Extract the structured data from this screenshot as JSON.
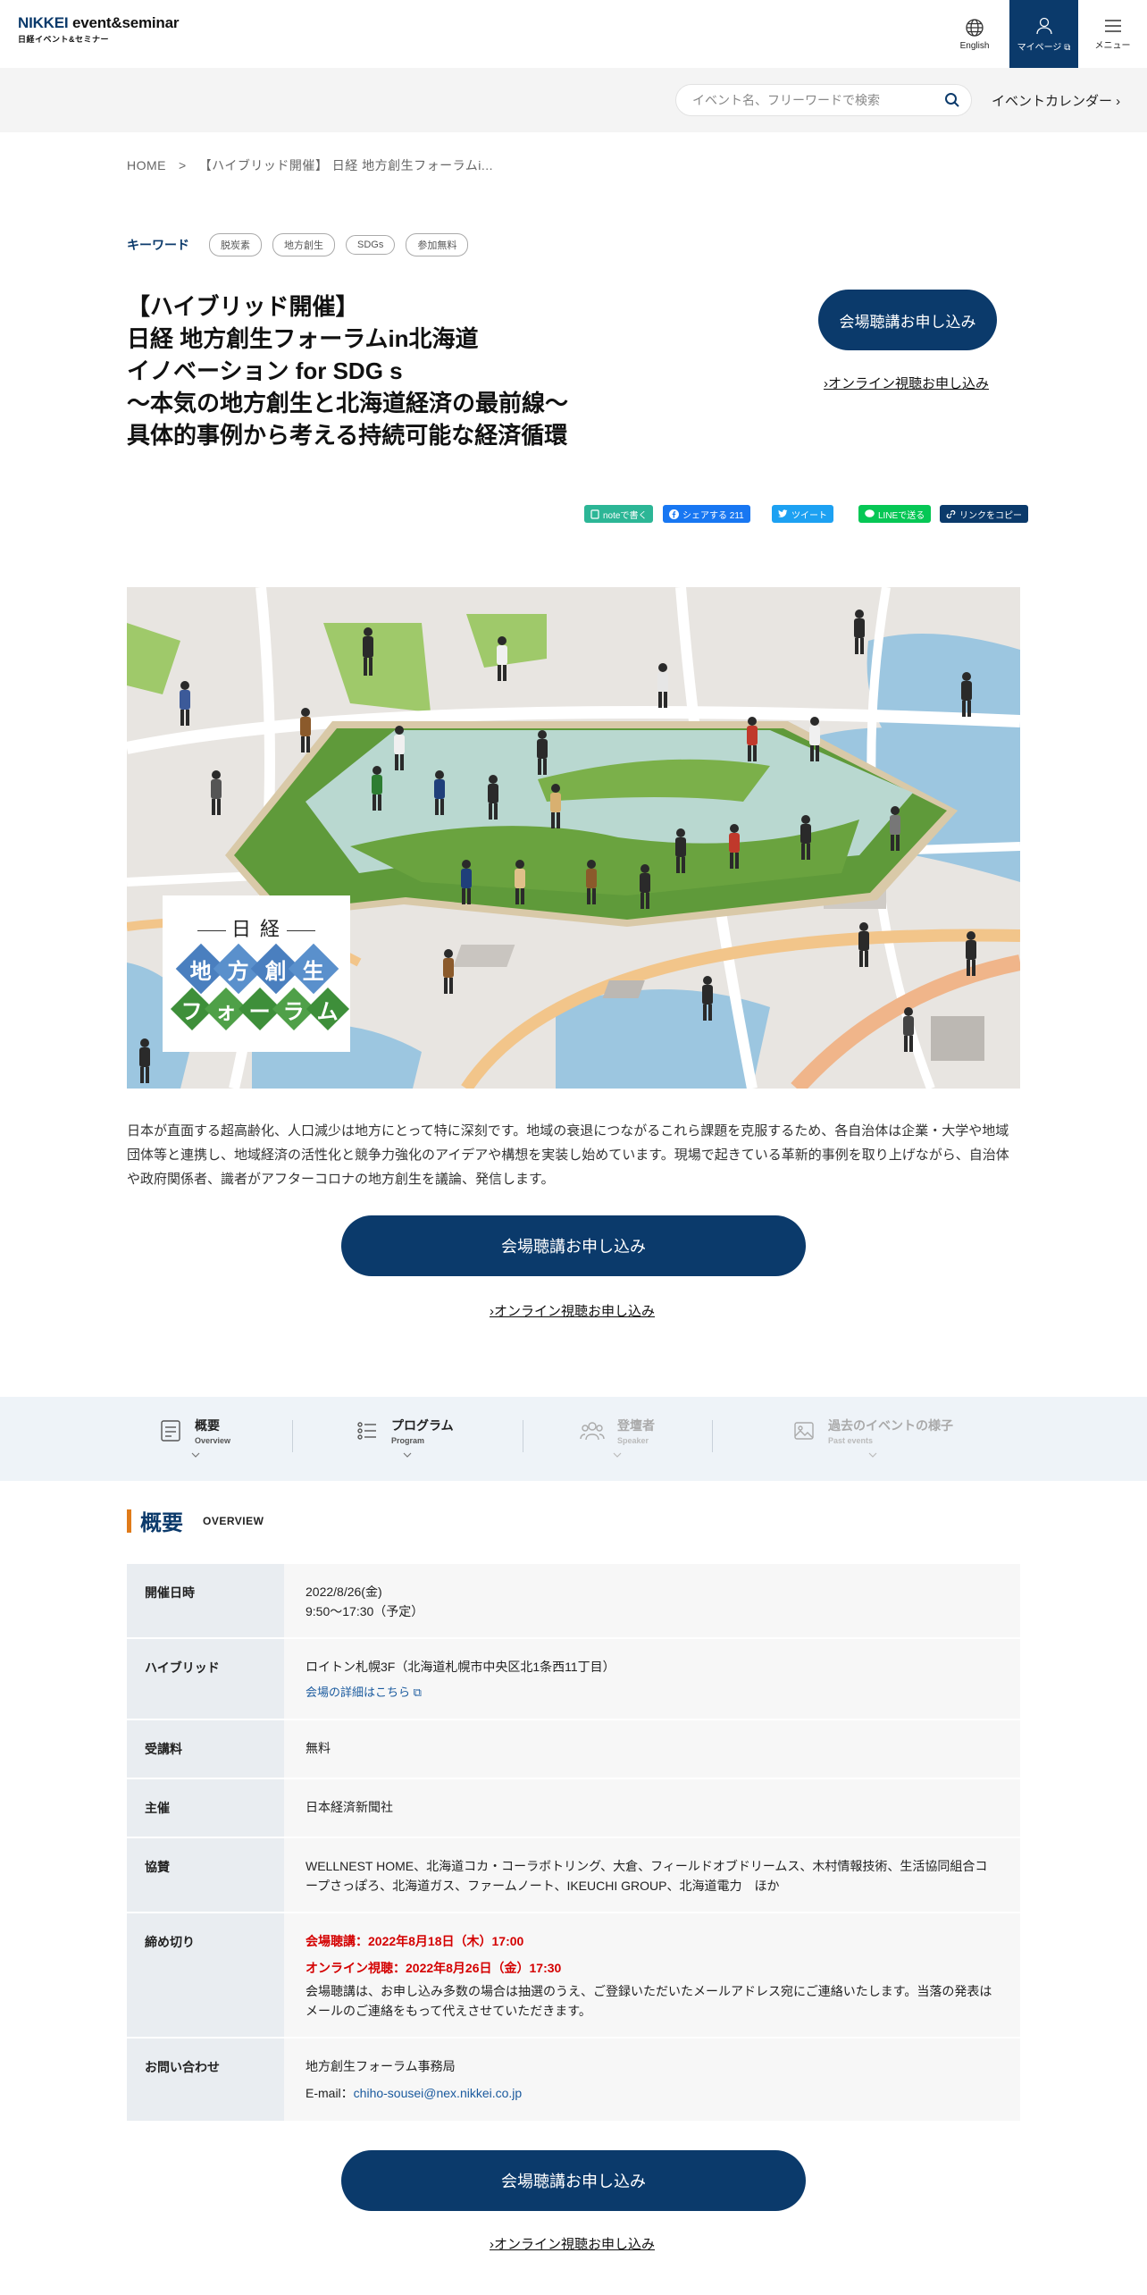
{
  "header": {
    "logo_main": "event&seminar",
    "logo_brand": "NIKKEI",
    "logo_sub": "日経イベント&セミナー",
    "english_label": "English",
    "mypage_label": "マイページ",
    "menu_label": "メニュー"
  },
  "search": {
    "placeholder": "イベント名、フリーワードで検索",
    "calendar_label": "イベントカレンダー ›"
  },
  "breadcrumb": {
    "home": "HOME",
    "sep": ">",
    "current": "【ハイブリッド開催】 日経 地方創生フォーラムi..."
  },
  "keywords": {
    "label": "キーワード",
    "tags": [
      "脱炭素",
      "地方創生",
      "SDGs",
      "参加無料"
    ]
  },
  "title_lines": [
    "【ハイブリッド開催】",
    "日経 地方創生フォーラムin北海道",
    "イノベーション for SDG s",
    "～本気の地方創生と北海道経済の最前線～",
    "具体的事例から考える持続可能な経済循環"
  ],
  "cta": {
    "venue_label": "会場聴講お申し込み",
    "online_label": "›オンライン視聴お申し込み"
  },
  "share": {
    "note": "noteで書く",
    "facebook": "シェアする 211",
    "twitter": "ツイート",
    "line": "LINEで送る",
    "copy": "リンクをコピー"
  },
  "hero": {
    "logo_top": "日 経",
    "logo_line1": [
      "地",
      "方",
      "創",
      "生"
    ],
    "logo_line2": [
      "フ",
      "ォ",
      "ー",
      "ラ",
      "ム"
    ]
  },
  "description": "日本が直面する超高齢化、人口減少は地方にとって特に深刻です。地域の衰退につながるこれら課題を克服するため、各自治体は企業・大学や地域団体等と連携し、地域経済の活性化と競争力強化のアイデアや構想を実装し始めています。現場で起きている革新的事例を取り上げながら、自治体や政府関係者、識者がアフターコロナの地方創生を議論、発信します。",
  "tabs": [
    {
      "jp": "概要",
      "en": "Overview"
    },
    {
      "jp": "プログラム",
      "en": "Program"
    },
    {
      "jp": "登壇者",
      "en": "Speaker"
    },
    {
      "jp": "過去のイベントの様子",
      "en": "Past events"
    }
  ],
  "overview": {
    "heading_jp": "概要",
    "heading_en": "OVERVIEW",
    "rows": {
      "date_label": "開催日時",
      "date_line1": "2022/8/26(金)",
      "date_line2": "9:50～17:30（予定）",
      "venue_label": "ハイブリッド",
      "venue_value": "ロイトン札幌3F（北海道札幌市中央区北1条西11丁目）",
      "venue_link": "会場の詳細はこちら",
      "fee_label": "受講料",
      "fee_value": "無料",
      "host_label": "主催",
      "host_value": "日本経済新聞社",
      "sponsor_label": "協賛",
      "sponsor_value": "WELLNEST HOME、北海道コカ・コーラボトリング、大倉、フィールドオブドリームス、木村情報技術、生活協同組合コープさっぽろ、北海道ガス、ファームノート、IKEUCHI GROUP、北海道電力　ほか",
      "deadline_label": "締め切り",
      "deadline_venue": "会場聴講：2022年8月18日（木）17:00",
      "deadline_online": "オンライン視聴：2022年8月26日（金）17:30",
      "deadline_note": "会場聴講は、お申し込み多数の場合は抽選のうえ、ご登録いただいたメールアドレス宛にご連絡いたします。当落の発表はメールのご連絡をもって代えさせていただきます。",
      "contact_label": "お問い合わせ",
      "contact_name": "地方創生フォーラム事務局",
      "contact_mail_label": "E-mail：",
      "contact_mail": "chiho-sousei@nex.nikkei.co.jp"
    }
  },
  "colors": {
    "navy": "#0b3a6b",
    "accent_orange": "#e07b1a",
    "deadline_red": "#d40000"
  }
}
